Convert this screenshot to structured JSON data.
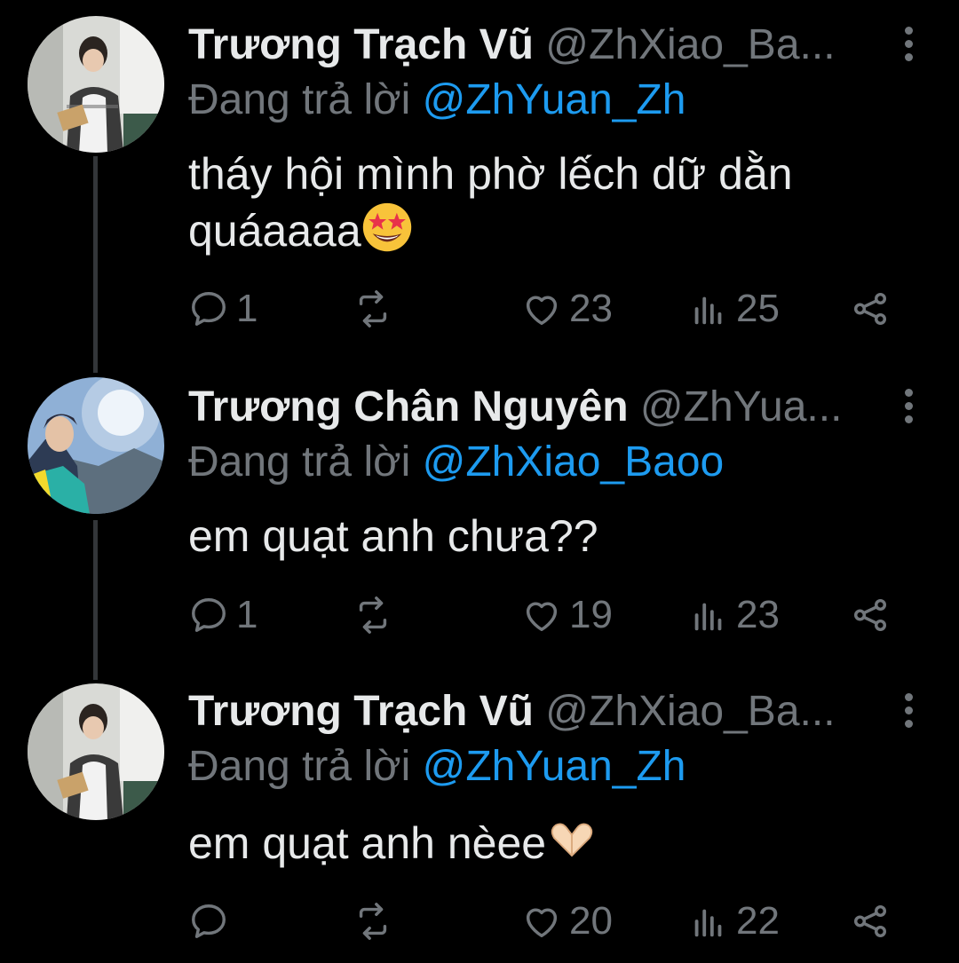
{
  "tweets": [
    {
      "name": "Trương Trạch Vũ",
      "handle": "@ZhXiao_Ba...",
      "reply_prefix": "Đang trả lời",
      "reply_to": "@ZhYuan_Zh",
      "text": "tháy hội mình phờ lếch dữ dằn quáaaaa",
      "emoji": "star-struck-emoji",
      "replies": "1",
      "retweets": "",
      "likes": "23",
      "views": "25"
    },
    {
      "name": "Trương Chân Nguyên",
      "handle": "@ZhYua...",
      "reply_prefix": "Đang trả lời",
      "reply_to": "@ZhXiao_Baoo",
      "text": "em quạt anh chưa??",
      "replies": "1",
      "retweets": "",
      "likes": "19",
      "views": "23"
    },
    {
      "name": "Trương Trạch Vũ",
      "handle": "@ZhXiao_Ba...",
      "reply_prefix": "Đang trả lời",
      "reply_to": "@ZhYuan_Zh",
      "text": "em quạt anh nèee",
      "emoji": "heart-hands-emoji",
      "replies": "",
      "retweets": "",
      "likes": "20",
      "views": "22"
    }
  ],
  "colors": {
    "background": "#000000",
    "text": "#e7e9ea",
    "muted": "#71767b",
    "mention": "#1d9bf0",
    "thread_line": "#333639"
  }
}
